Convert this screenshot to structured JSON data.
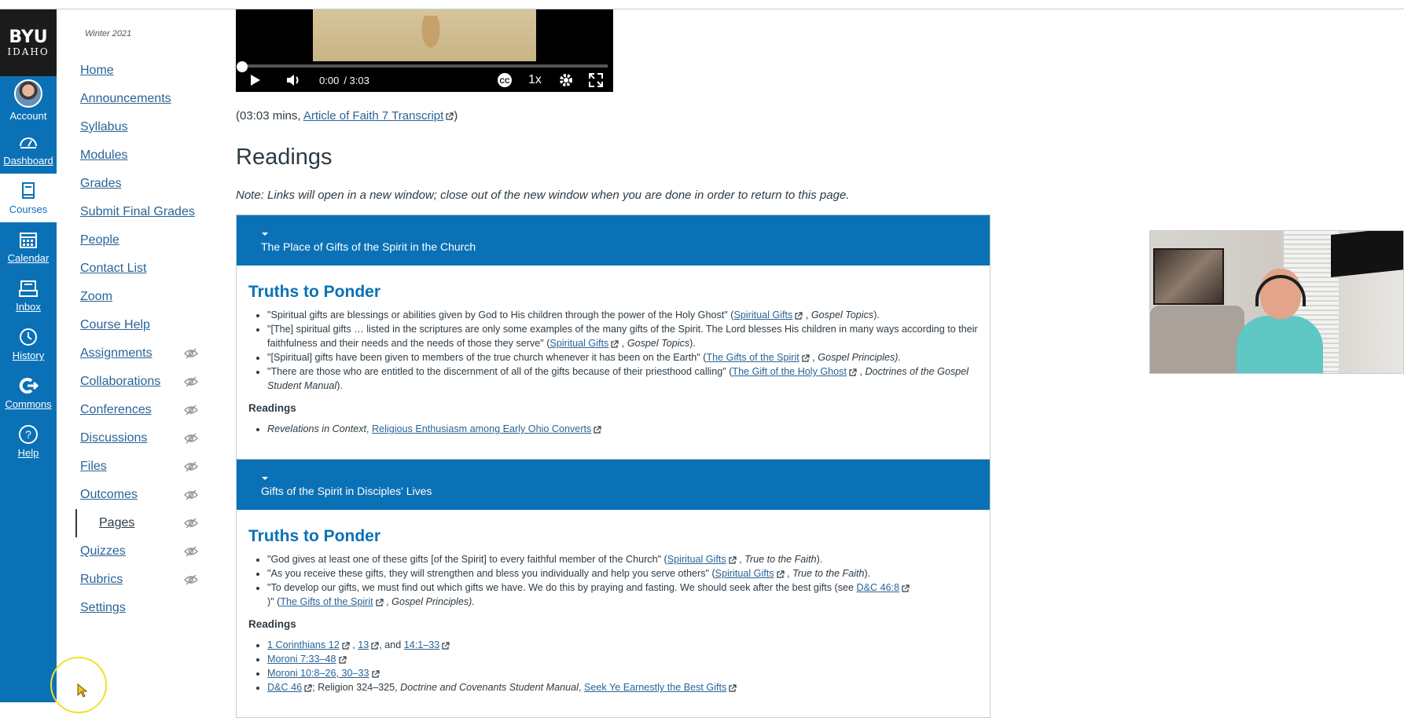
{
  "global_nav": {
    "logo_line1": "BYU",
    "logo_line2": "IDAHO",
    "items": [
      {
        "label": "Account",
        "icon": "avatar"
      },
      {
        "label": "Dashboard",
        "icon": "dashboard-icon"
      },
      {
        "label": "Courses",
        "icon": "courses-icon"
      },
      {
        "label": "Calendar",
        "icon": "calendar-icon"
      },
      {
        "label": "Inbox",
        "icon": "inbox-icon"
      },
      {
        "label": "History",
        "icon": "history-icon"
      },
      {
        "label": "Commons",
        "icon": "commons-icon"
      },
      {
        "label": "Help",
        "icon": "help-icon"
      }
    ],
    "color": "#0a71b6"
  },
  "course_nav": {
    "term": "Winter 2021",
    "items": [
      {
        "label": "Home"
      },
      {
        "label": "Announcements"
      },
      {
        "label": "Syllabus"
      },
      {
        "label": "Modules"
      },
      {
        "label": "Grades"
      },
      {
        "label": "Submit Final Grades"
      },
      {
        "label": "People"
      },
      {
        "label": "Contact List"
      },
      {
        "label": "Zoom"
      },
      {
        "label": "Course Help"
      },
      {
        "label": "Assignments",
        "hidden": true
      },
      {
        "label": "Collaborations",
        "hidden": true
      },
      {
        "label": "Conferences",
        "hidden": true
      },
      {
        "label": "Discussions",
        "hidden": true
      },
      {
        "label": "Files",
        "hidden": true
      },
      {
        "label": "Outcomes",
        "hidden": true
      },
      {
        "label": "Pages",
        "hidden": true,
        "active": true
      },
      {
        "label": "Quizzes",
        "hidden": true
      },
      {
        "label": "Rubrics",
        "hidden": true
      },
      {
        "label": "Settings"
      }
    ]
  },
  "video": {
    "current_time": "0:00",
    "total_time": "/ 3:03",
    "speed": "1x",
    "progress": 0
  },
  "content": {
    "duration_prefix": "(03:03 mins, ",
    "transcript_link": "Article of Faith 7 Transcript",
    "duration_suffix": ")",
    "heading": "Readings",
    "note": "Note: Links will open in a new window; close out of the new window when you are done in order to return to this page.",
    "panels": [
      {
        "title": "The Place of Gifts of the Spirit in the Church",
        "truths_heading": "Truths to Ponder",
        "readings_heading": "Readings"
      },
      {
        "title": "Gifts of the Spirit in Disciples' Lives",
        "truths_heading": "Truths to Ponder",
        "readings_heading": "Readings"
      }
    ]
  },
  "p1": {
    "b1_text": "\"Spiritual gifts are blessings or abilities given by God to His children through the power of the Holy Ghost\" (",
    "b1_link": "Spiritual Gifts",
    "b1_src": "Gospel Topics",
    "b2_text": "\"[The] spiritual gifts … listed in the scriptures are only some examples of the many gifts of the Spirit. The Lord blesses His children in many ways according to their faithfulness and their needs and the needs of those they serve\" (",
    "b2_link": "Spiritual Gifts",
    "b2_src": "Gospel Topics",
    "b3_text": "\"[Spiritual] gifts have been given to members of the true church whenever it has been on the Earth\" (",
    "b3_link": "The Gifts of the Spirit",
    "b3_src": "Gospel Principles",
    "b4_text": "\"There are those who are entitled to the discernment of all of the gifts because of their priesthood calling\" (",
    "b4_link": "The Gift of the Holy Ghost",
    "b4_src": "Doctrines of the Gospel Student Manual",
    "r1_src": "Revelations in Context",
    "r1_link": "Religious Enthusiasm among Early Ohio Converts"
  },
  "p2": {
    "b1_text": "\"God gives at least one of these gifts [of the Spirit] to every faithful member of the Church\" (",
    "b1_link": "Spiritual Gifts",
    "b1_src": "True to the Faith",
    "b2_text": "\"As you receive these gifts, they will strengthen and bless you individually and help you serve others\" (",
    "b2_link": "Spiritual Gifts",
    "b2_src": "True to the Faith",
    "b3_text": "\"To develop our gifts, we must find out which gifts we have. We do this by praying and fasting. We should seek after the best gifts (see ",
    "b3_link1": "D&C 46:8",
    "b3_mid": ")\" (",
    "b3_link2": "The Gifts of the Spirit",
    "b3_src": "Gospel Principles",
    "r1_a": "1 Corinthians 12",
    "r1_b": "13",
    "r1_and": ", and ",
    "r1_c": "14:1–33",
    "r2": "Moroni 7:33–48",
    "r3": "Moroni 10:8–26, 30–33",
    "r4_a": "D&C 46",
    "r4_mid": "; Religion 324–325, ",
    "r4_src": "Doctrine and Covenants Student Manual",
    "r4_b": "Seek Ye Earnestly the Best Gifts"
  }
}
